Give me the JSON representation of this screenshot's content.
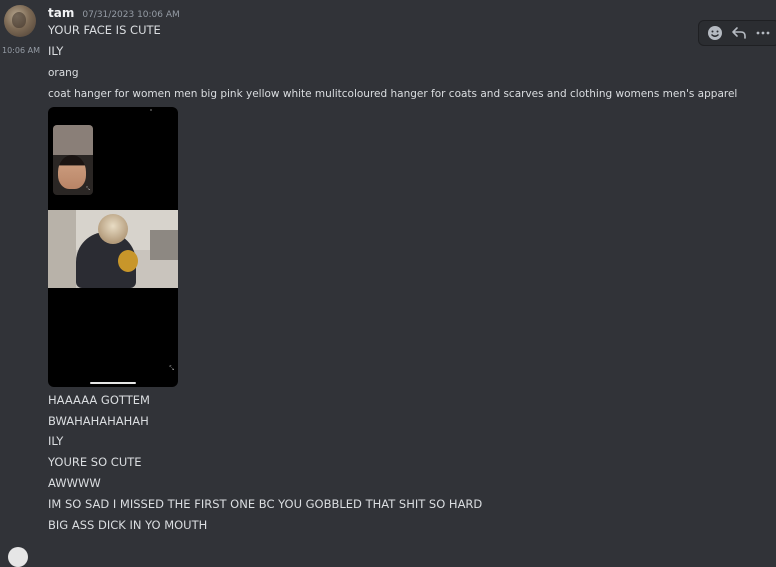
{
  "author": {
    "username": "tam",
    "timestamp": "07/31/2023 10:06 AM"
  },
  "hover_timestamp": "10:06 AM",
  "toolbar": {
    "icons": [
      "add-reaction-icon",
      "reply-icon",
      "more-icon"
    ]
  },
  "messages_before": [
    "YOUR FACE IS CUTE",
    "ILY",
    "orang",
    "coat hanger for women men big pink yellow white mulitcoloured hanger for coats and scarves and clothing womens men's apparel"
  ],
  "messages_after": [
    "HAAAAA GOTTEM",
    "BWAHAHAHAHAH",
    "ILY",
    "YOURE SO CUTE",
    "AWWWW",
    "IM SO SAD I MISSED THE FIRST ONE BC YOU GOBBLED THAT SHIT SO HARD",
    "BIG ASS DICK IN YO MOUTH"
  ]
}
